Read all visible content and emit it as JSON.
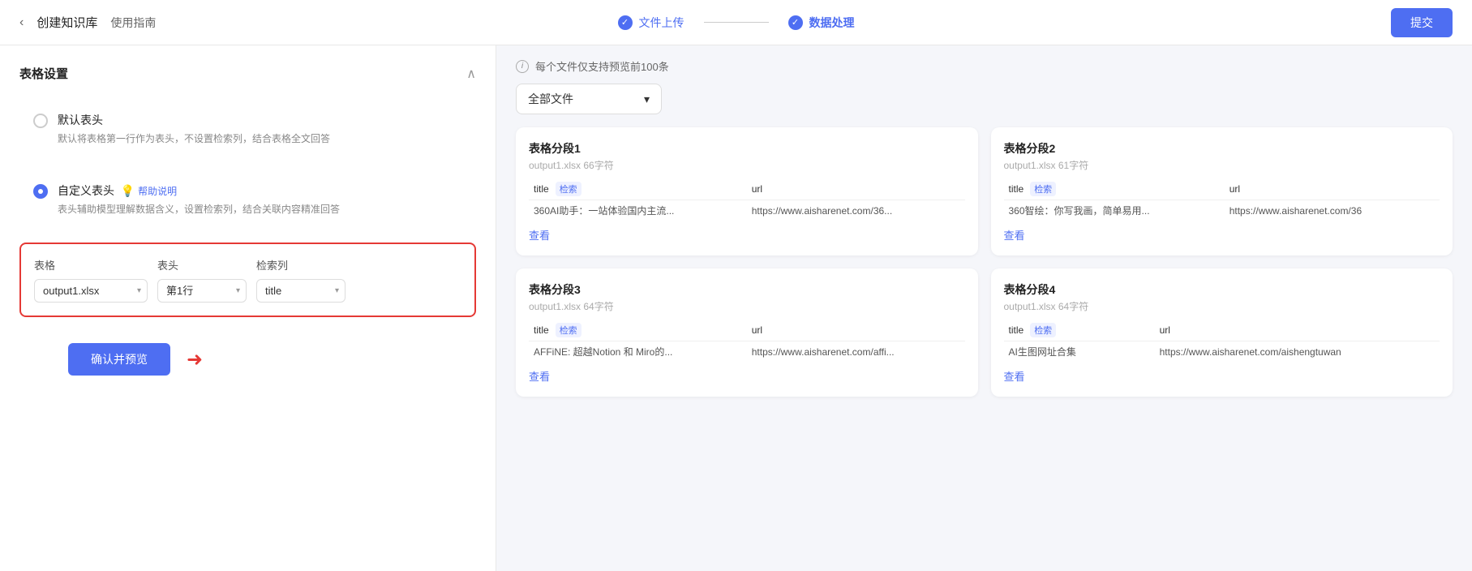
{
  "header": {
    "back_label": "‹",
    "title": "创建知识库",
    "guide_label": "使用指南",
    "step1_label": "文件上传",
    "step2_label": "数据处理",
    "submit_label": "提交"
  },
  "left": {
    "section_title": "表格设置",
    "collapse_icon": "∧",
    "option1": {
      "title": "默认表头",
      "desc": "默认将表格第一行作为表头，不设置检索列，结合表格全文回答"
    },
    "option2": {
      "title": "自定义表头",
      "help_label": "帮助说明",
      "desc": "表头辅助模型理解数据含义，设置检索列，结合关联内容精准回答"
    },
    "table_label": "表格",
    "header_label": "表头",
    "search_col_label": "检索列",
    "table_options": [
      "output1.xlsx"
    ],
    "header_options": [
      "第1行"
    ],
    "search_col_options": [
      "title"
    ],
    "confirm_label": "确认并预览"
  },
  "right": {
    "preview_info": "每个文件仅支持预览前100条",
    "file_dropdown_label": "全部文件",
    "segments": [
      {
        "name": "表格分段1",
        "meta": "output1.xlsx  66字符",
        "col_title": "title",
        "col_url": "url",
        "row_title": "360AI助手：一站体验国内主流...",
        "row_url": "https://www.aisharenet.com/36...",
        "view_label": "查看"
      },
      {
        "name": "表格分段2",
        "meta": "output1.xlsx  61字符",
        "col_title": "title",
        "col_url": "url",
        "row_title": "360智绘：你写我画，简单易用...",
        "row_url": "https://www.aisharenet.com/36",
        "view_label": "查看"
      },
      {
        "name": "表格分段3",
        "meta": "output1.xlsx  64字符",
        "col_title": "title",
        "col_url": "url",
        "row_title": "AFFiNE: 超越Notion 和 Miro的...",
        "row_url": "https://www.aisharenet.com/affi...",
        "view_label": "查看"
      },
      {
        "name": "表格分段4",
        "meta": "output1.xlsx  64字符",
        "col_title": "title",
        "col_url": "url",
        "row_title": "AI生图网址合集",
        "row_url": "https://www.aisharenet.com/aishengtuwan",
        "view_label": "查看"
      }
    ]
  }
}
